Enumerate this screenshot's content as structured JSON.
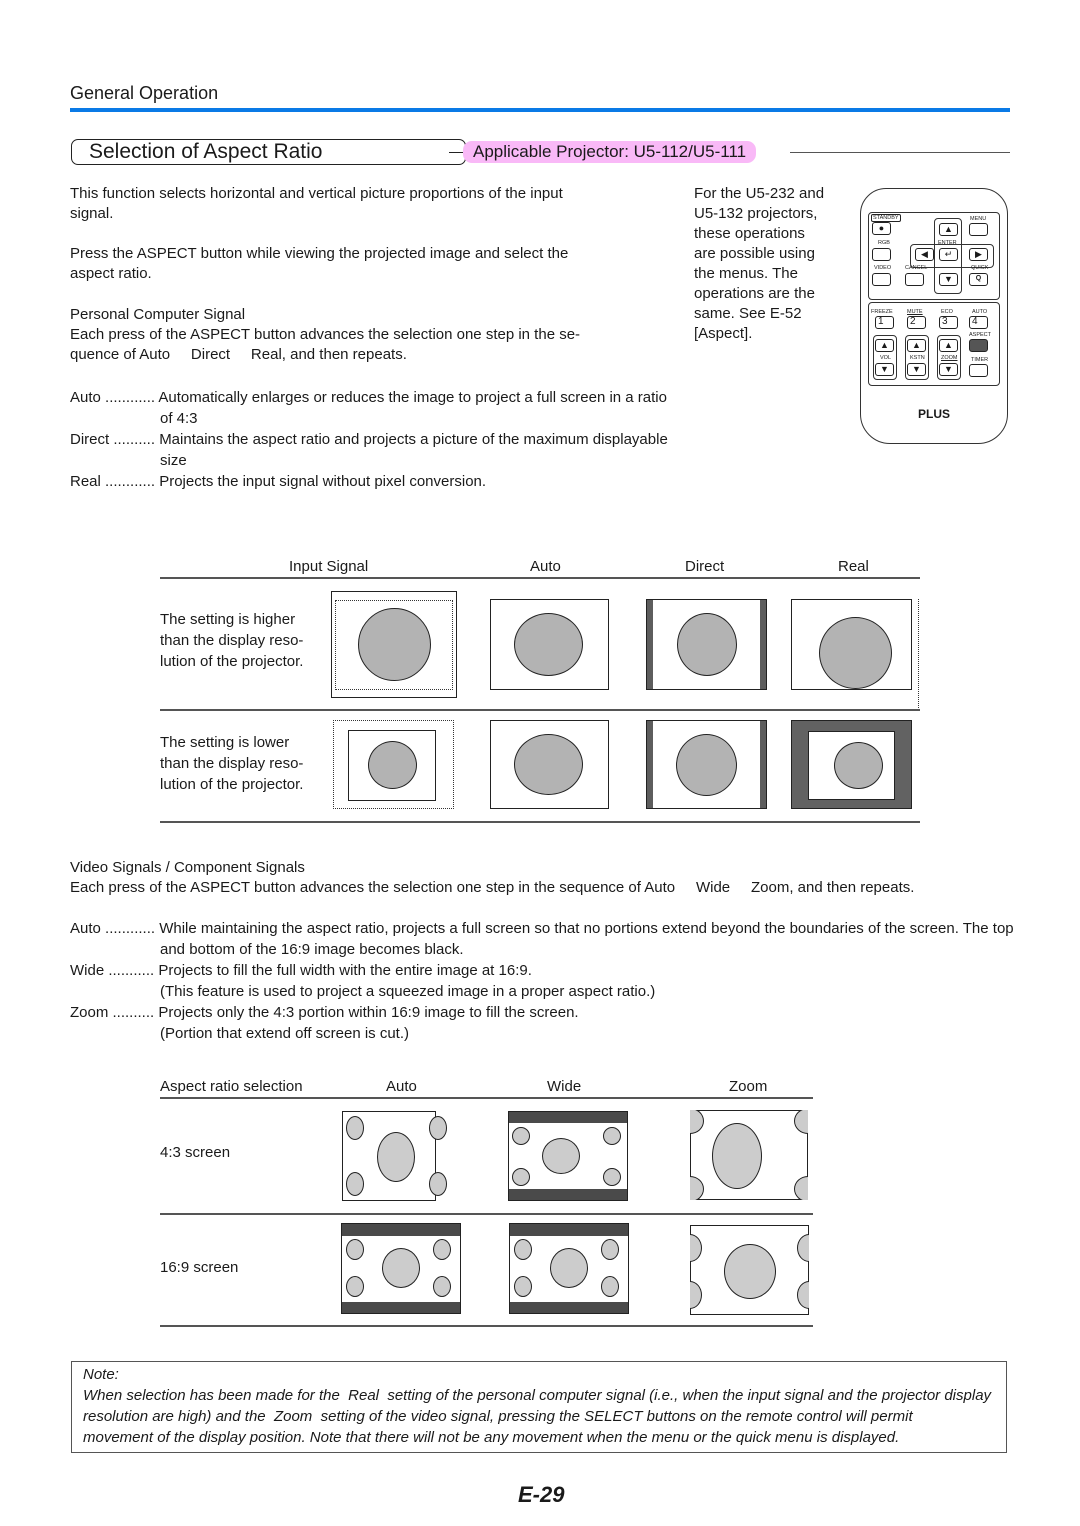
{
  "header": {
    "section_label": "General Operation",
    "accent_color": "#0a7ae6"
  },
  "title": {
    "text": "Selection of Aspect Ratio",
    "applicable_badge": "Applicable Projector: U5-112/U5-111",
    "badge_color": "#f9b9f7"
  },
  "intro": {
    "para1_line1": "This function selects horizontal and vertical picture proportions of the input",
    "para1_line2": "signal.",
    "para2_line1": "Press the ASPECT button while viewing the projected image and select the",
    "para2_line2": "aspect ratio.",
    "pc_heading": "Personal Computer Signal",
    "pc_line1": "Each press of the ASPECT button advances the selection one step in the se-",
    "pc_line2": "quence of Auto     Direct     Real, and then repeats."
  },
  "side_note": {
    "lines": [
      "For the U5-232 and",
      "U5-132 projectors,",
      "these operations",
      "are possible using",
      "the menus. The",
      "operations are the",
      "same. See E-52",
      "[Aspect]."
    ]
  },
  "remote": {
    "brand": "PLUS",
    "labels": {
      "standby": "STANDBY",
      "menu": "MENU",
      "rgb": "RGB",
      "enter": "ENTER",
      "video": "VIDEO",
      "cancel": "CANCEL",
      "quick": "QUICK",
      "freeze": "FREEZE",
      "mute": "MUTE",
      "eco": "ECO",
      "auto": "AUTO",
      "aspect": "ASPECT",
      "vol": "VOL",
      "kstn": "KSTN",
      "zoom": "ZOOM",
      "timer": "TIMER"
    },
    "numbers": [
      "1",
      "2",
      "3",
      "4"
    ],
    "glyphs": {
      "up": "▲",
      "down": "▼",
      "left": "◀",
      "right": "▶",
      "enter": "↵",
      "dot": "●",
      "quick": "Q"
    }
  },
  "pc_definitions": [
    {
      "term": "Auto ............",
      "desc": "Automatically enlarges or reduces the image to project a full screen in a ratio",
      "cont": "of 4:3"
    },
    {
      "term": "Direct ..........",
      "desc": "Maintains the aspect ratio and projects a picture of the maximum displayable",
      "cont": "size"
    },
    {
      "term": "Real ............",
      "desc": "Projects the input signal without pixel conversion.",
      "cont": ""
    }
  ],
  "pc_table": {
    "headers": [
      "Input Signal",
      "Auto",
      "Direct",
      "Real"
    ],
    "rows": [
      {
        "label": [
          "The setting is higher",
          "than the display reso-",
          "lution of the projector."
        ]
      },
      {
        "label": [
          "The setting is lower",
          "than the display reso-",
          "lution of the projector."
        ]
      }
    ]
  },
  "video": {
    "heading": "Video Signals / Component Signals",
    "sequence": "Each press of the ASPECT button advances the selection one step in the sequence of Auto     Wide     Zoom, and then repeats.",
    "definitions": [
      {
        "term": "Auto ............",
        "desc": "While maintaining the aspect ratio, projects a full screen so that no portions extend beyond the boundaries of the screen. The top",
        "cont": "and bottom of the 16:9 image becomes black."
      },
      {
        "term": "Wide ...........",
        "desc": "Projects to fill the full width with the entire image at 16:9.",
        "cont": "(This feature is used to project a squeezed image in a proper aspect ratio.)"
      },
      {
        "term": "Zoom ..........",
        "desc": "Projects only the 4:3 portion within 16:9 image to fill the screen.",
        "cont": "(Portion that extend off screen is cut.)"
      }
    ]
  },
  "video_table": {
    "headers": [
      "Aspect ratio selection",
      "Auto",
      "Wide",
      "Zoom"
    ],
    "rows": [
      {
        "label": "4:3 screen"
      },
      {
        "label": "16:9 screen"
      }
    ]
  },
  "note": {
    "title": "Note:",
    "lines": [
      "When selection has been made for the  Real  setting of the personal computer signal (i.e., when the input signal and the projector display",
      "resolution are high) and the  Zoom  setting of the video signal, pressing the SELECT buttons on the remote control will permit",
      "movement of the display position. Note that there will not be any movement when the menu or the quick menu is displayed."
    ]
  },
  "footer": {
    "page_number": "E-29"
  }
}
